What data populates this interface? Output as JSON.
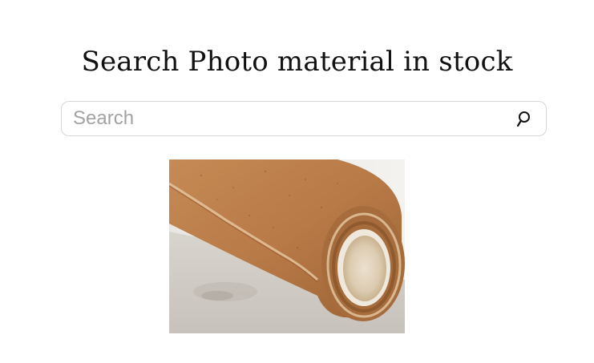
{
  "page": {
    "title": "Search Photo material in stock"
  },
  "search": {
    "placeholder": "Search",
    "value": "",
    "icon": "search-icon"
  },
  "result": {
    "image_subject": "rolled cork sheet on wooden table"
  }
}
